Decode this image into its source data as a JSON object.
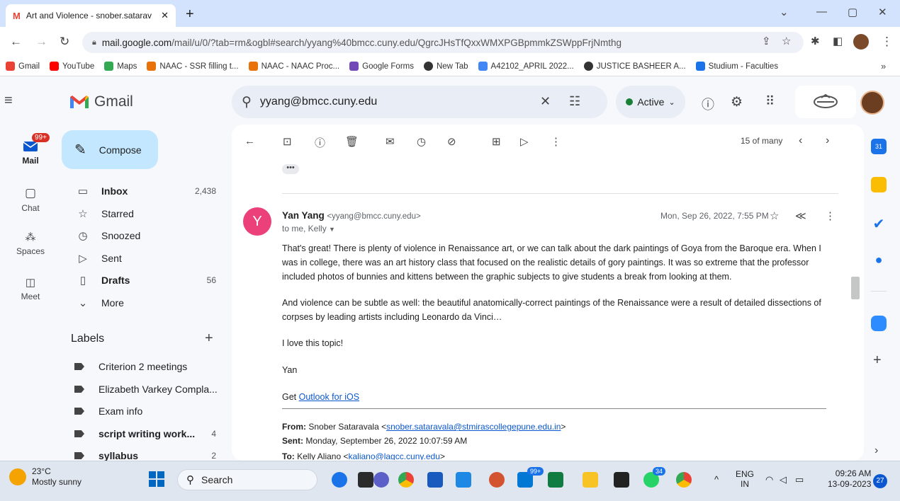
{
  "browser": {
    "tab_title": "Art and Violence - snober.satarav",
    "url_host": "mail.google.com",
    "url_path": "/mail/u/0/?tab=rm&ogbl#search/yyang%40bmcc.cuny.edu/QgrcJHsTfQxxWMXPGBpmmkZSWppFrjNmthg",
    "bookmarks": [
      {
        "label": "Gmail",
        "color": "#ea4335"
      },
      {
        "label": "YouTube",
        "color": "#ff0000"
      },
      {
        "label": "Maps",
        "color": "#34a853"
      },
      {
        "label": "NAAC - SSR filling t...",
        "color": "#e8710a"
      },
      {
        "label": "NAAC - NAAC Proc...",
        "color": "#e8710a"
      },
      {
        "label": "Google Forms",
        "color": "#7248b9"
      },
      {
        "label": "New Tab",
        "color": "#333333"
      },
      {
        "label": "A42102_APRIL 2022...",
        "color": "#4285f4"
      },
      {
        "label": "JUSTICE BASHEER A...",
        "color": "#333333"
      },
      {
        "label": "Studium - Faculties",
        "color": "#1a73e8"
      }
    ],
    "more_bookmarks": "»"
  },
  "gmail": {
    "logo_text": "Gmail",
    "search_value": "yyang@bmcc.cuny.edu",
    "status": "Active",
    "rail": [
      {
        "label": "Mail",
        "badge": "99+"
      },
      {
        "label": "Chat"
      },
      {
        "label": "Spaces"
      },
      {
        "label": "Meet"
      }
    ],
    "compose_label": "Compose",
    "nav": [
      {
        "label": "Inbox",
        "count": "2,438",
        "bold": true,
        "icon": "inbox-icon",
        "glyph": "▭"
      },
      {
        "label": "Starred",
        "count": "",
        "bold": false,
        "icon": "star-icon",
        "glyph": "☆"
      },
      {
        "label": "Snoozed",
        "count": "",
        "bold": false,
        "icon": "clock-icon",
        "glyph": "◷"
      },
      {
        "label": "Sent",
        "count": "",
        "bold": false,
        "icon": "send-icon",
        "glyph": "▷"
      },
      {
        "label": "Drafts",
        "count": "56",
        "bold": true,
        "icon": "draft-icon",
        "glyph": "▯"
      },
      {
        "label": "More",
        "count": "",
        "bold": false,
        "icon": "chevron-down-icon",
        "glyph": "⌄"
      }
    ],
    "labels_title": "Labels",
    "labels": [
      {
        "label": "Criterion 2 meetings",
        "count": "",
        "bold": false
      },
      {
        "label": "Elizabeth Varkey Compla...",
        "count": "",
        "bold": false
      },
      {
        "label": "Exam info",
        "count": "",
        "bold": false
      },
      {
        "label": "script writing work...",
        "count": "4",
        "bold": true
      },
      {
        "label": "syllabus",
        "count": "2",
        "bold": true
      }
    ],
    "pager": "15 of many"
  },
  "email": {
    "avatar_letter": "Y",
    "avatar_color": "#ec407a",
    "sender_name": "Yan Yang",
    "sender_email": "<yyang@bmcc.cuny.edu>",
    "to_line": "to me, Kelly",
    "date": "Mon, Sep 26, 2022, 7:55 PM",
    "paragraphs": [
      "That's great! There is plenty of violence in Renaissance art, or we can talk about the dark paintings of Goya from the Baroque era. When I was in college, there was an art history class that focused on the realistic details of gory paintings. It was so extreme that the professor included photos of bunnies and kittens between the graphic subjects to give students a break from looking at them.",
      "And violence can be subtle as well: the beautiful anatomically-correct paintings of the Renaissance were a result of detailed dissections of corpses by leading artists including Leonardo da Vinci…",
      "I love this topic!",
      "Yan"
    ],
    "signature_prefix": "Get ",
    "signature_link": "Outlook for iOS",
    "fwd_from_label": "From:",
    "fwd_from_name": "Snober Sataravala <",
    "fwd_from_email": "snober.sataravala@stmirascollegepune.edu.in",
    "fwd_from_close": ">",
    "fwd_sent_label": "Sent:",
    "fwd_sent_value": "Monday, September 26, 2022 10:07:59 AM",
    "fwd_to_label": "To:",
    "fwd_to_name": "Kelly Aliano <",
    "fwd_to_email": "kaliano@lagcc.cuny.edu",
    "fwd_to_close": ">"
  },
  "taskbar": {
    "temperature": "23°C",
    "weather": "Mostly sunny",
    "search_label": "Search",
    "badge_store": "99+",
    "badge_whatsapp": "34",
    "language_top": "ENG",
    "language_bottom": "IN",
    "time": "09:26 AM",
    "date": "13-09-2023",
    "notifications": "27"
  }
}
